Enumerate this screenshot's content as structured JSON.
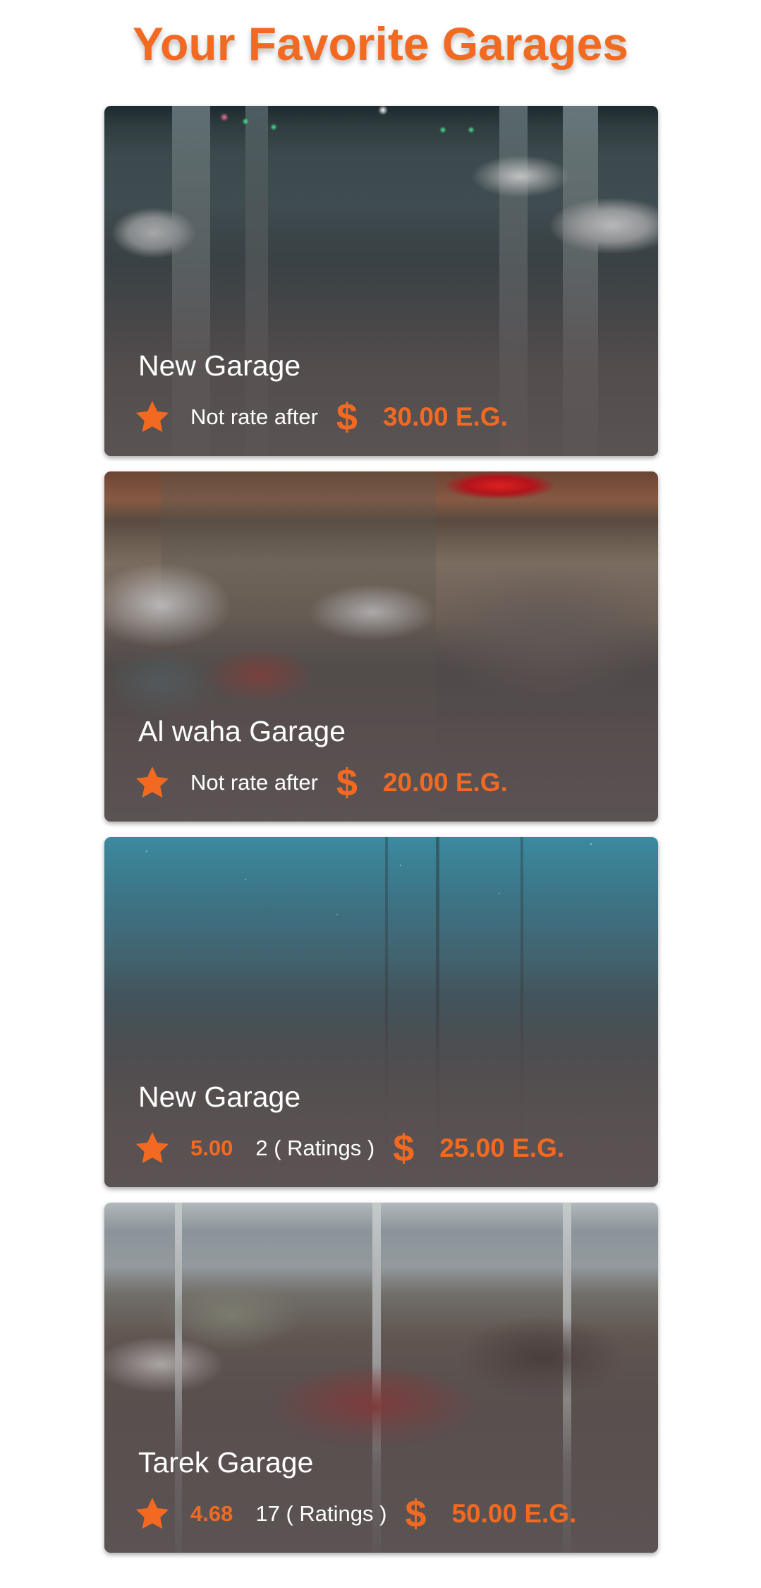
{
  "header": {
    "title": "Your Favorite Garages"
  },
  "colors": {
    "accent": "#f26a21",
    "text_on_card": "#ffffff",
    "background": "#ffffff"
  },
  "icons": {
    "rating": "star-icon",
    "price": "dollar-icon",
    "dollar_glyph": "$"
  },
  "garages": [
    {
      "name": "New Garage",
      "rating": "",
      "rating_text": "Not rate after",
      "price": "30.00 E.G.",
      "photo": "underground parking garage"
    },
    {
      "name": "Al waha Garage",
      "rating": "",
      "rating_text": "Not rate after",
      "price": "20.00 E.G.",
      "photo": "car workshop interior"
    },
    {
      "name": "New Garage",
      "rating": "5.00",
      "rating_text": "2 ( Ratings )",
      "price": "25.00 E.G.",
      "photo": "misty forest"
    },
    {
      "name": "Tarek Garage",
      "rating": "4.68",
      "rating_text": "17 ( Ratings )",
      "price": "50.00 E.G.",
      "photo": "classic car showroom"
    }
  ]
}
